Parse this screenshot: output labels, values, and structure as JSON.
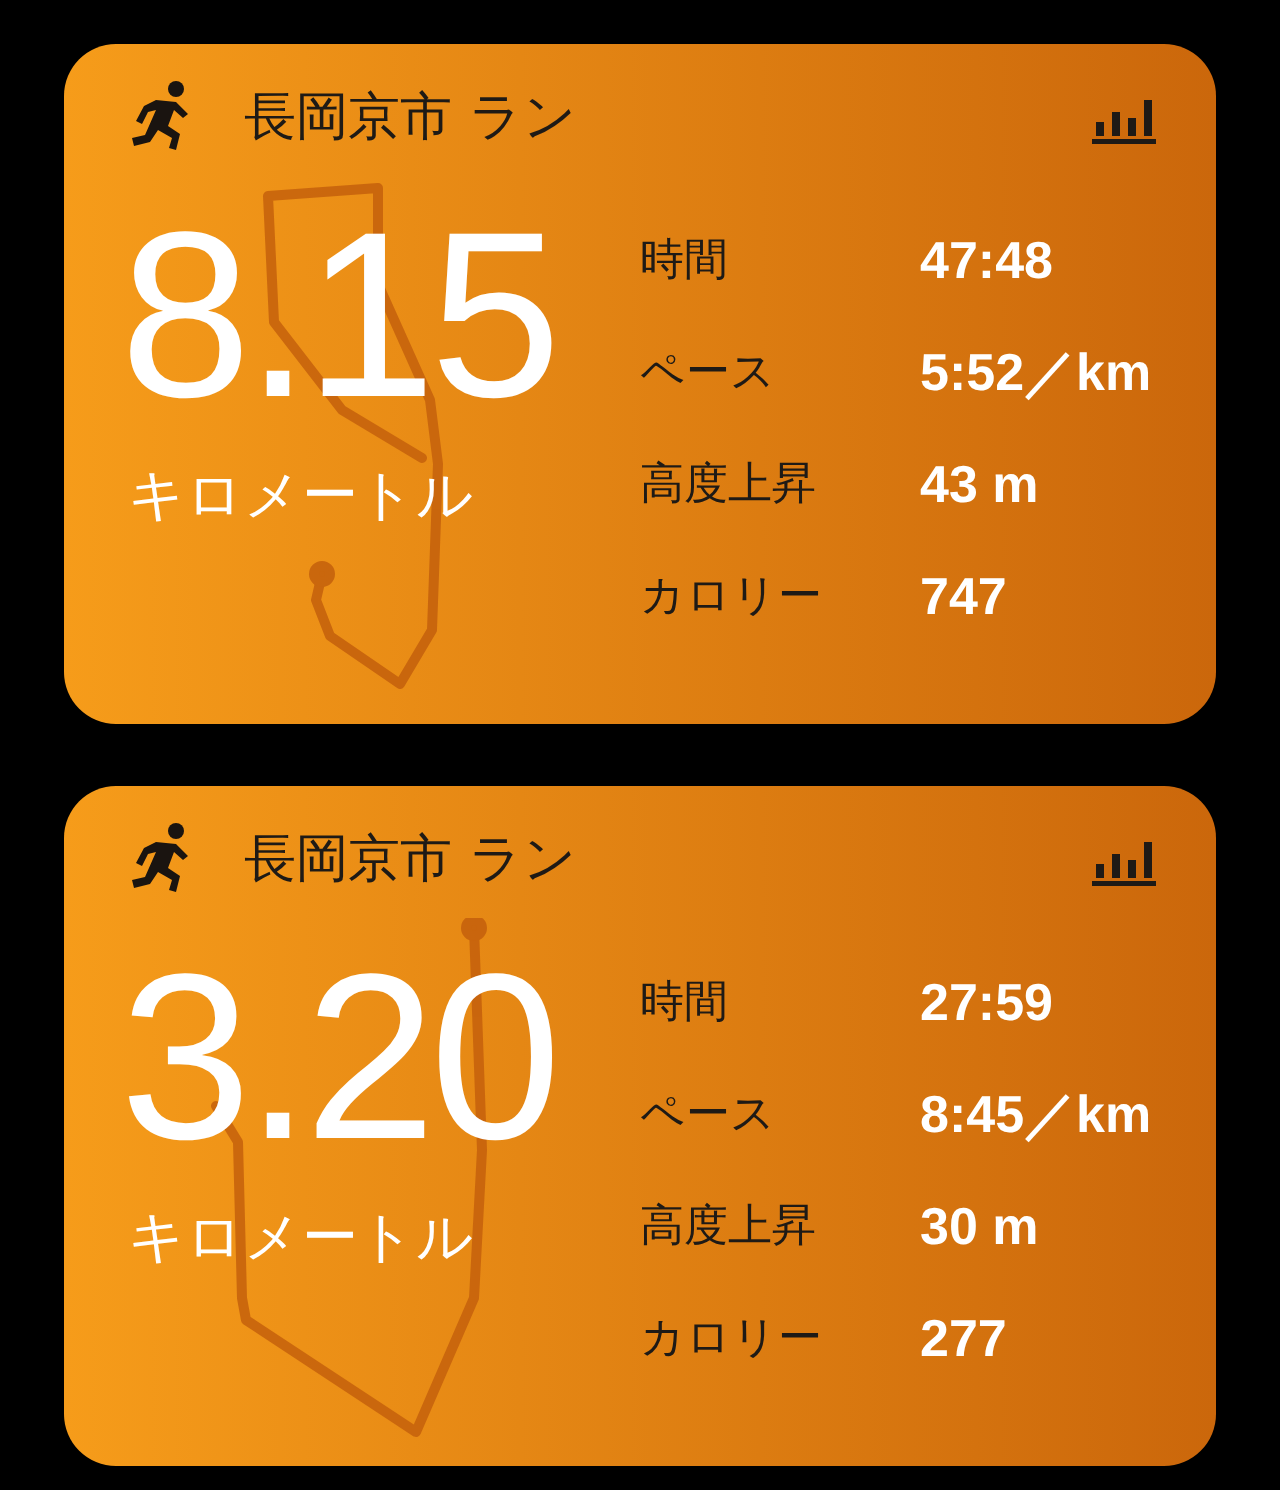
{
  "workouts": [
    {
      "title": "長岡京市 ラン",
      "distance": "8.15",
      "unit": "キロメートル",
      "stats": [
        {
          "label": "時間",
          "value": "47:48"
        },
        {
          "label": "ペース",
          "value": "5:52／km"
        },
        {
          "label": "高度上昇",
          "value": "43 m"
        },
        {
          "label": "カロリー",
          "value": "747"
        }
      ]
    },
    {
      "title": "長岡京市 ラン",
      "distance": "3.20",
      "unit": "キロメートル",
      "stats": [
        {
          "label": "時間",
          "value": "27:59"
        },
        {
          "label": "ペース",
          "value": "8:45／km"
        },
        {
          "label": "高度上昇",
          "value": "30 m"
        },
        {
          "label": "カロリー",
          "value": "277"
        }
      ]
    }
  ]
}
